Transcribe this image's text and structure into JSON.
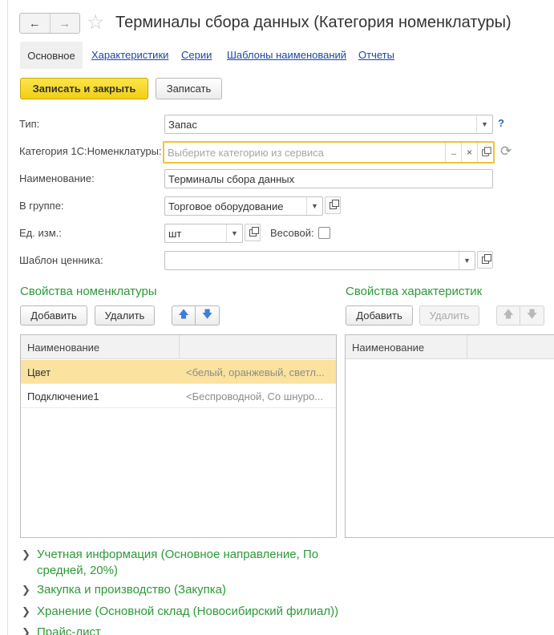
{
  "window": {
    "title": "Терминалы сбора данных (Категория номенклатуры)",
    "back_icon": "←",
    "forward_icon": "→",
    "favorite_icon": "☆"
  },
  "tabs": {
    "active": "Основное",
    "links": [
      "Характеристики",
      "Серии",
      "Шаблоны наименований",
      "Отчеты"
    ]
  },
  "toolbar": {
    "save_close_label": "Записать и закрыть",
    "save_label": "Записать"
  },
  "form": {
    "type_label": "Тип:",
    "type_value": "Запас",
    "help": "?",
    "category_label": "Категория 1С:Номенклатуры:",
    "category_placeholder": "Выберите категорию из сервиса",
    "dots": "...",
    "clear": "×",
    "name_label": "Наименование:",
    "name_value": "Терминалы сбора данных",
    "group_label": "В группе:",
    "group_value": "Торговое оборудование",
    "unit_label": "Ед. изм.:",
    "unit_value": "шт",
    "weight_label": "Весовой:",
    "weight_checked": false,
    "price_tag_label": "Шаблон ценника:",
    "price_tag_value": ""
  },
  "nomenclature_props": {
    "title": "Свойства номенклатуры",
    "add_label": "Добавить",
    "delete_label": "Удалить",
    "column_name": "Наименование",
    "rows": [
      {
        "name": "Цвет",
        "values": "<белый, оранжевый, светл...",
        "selected": true
      },
      {
        "name": "Подключение1",
        "values": "<Беспроводной, Со шнуро...",
        "selected": false
      }
    ]
  },
  "characteristic_props": {
    "title": "Свойства характеристик",
    "add_label": "Добавить",
    "delete_label": "Удалить",
    "column_name": "Наименование"
  },
  "groups": [
    {
      "line1": "Учетная информация (Основное направление, По",
      "line2": "средней, 20%)"
    },
    {
      "line1": "Закупка и производство (Закупка)"
    },
    {
      "line1": "Хранение (Основной склад (Новосибирский филиал))"
    },
    {
      "line1": "Прайс-лист"
    }
  ],
  "colors": {
    "accent_green": "#2c9a37",
    "primary_button": "#f2cf14",
    "link_blue": "#1a47a6",
    "selected_row": "#fae29f"
  }
}
